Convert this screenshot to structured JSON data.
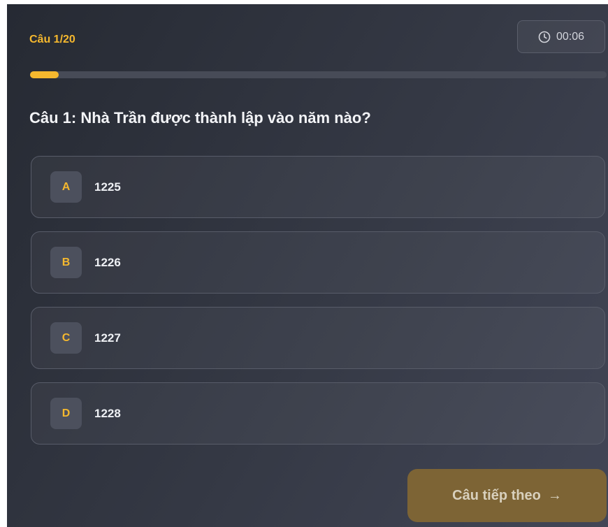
{
  "header": {
    "counter": "Câu 1/20",
    "timer": "00:06",
    "timer_icon": "clock-icon",
    "progress": 0.05
  },
  "question": "Câu 1: Nhà Trần được thành lập vào năm nào?",
  "options": [
    {
      "letter": "A",
      "text": "1225"
    },
    {
      "letter": "B",
      "text": "1226"
    },
    {
      "letter": "C",
      "text": "1227"
    },
    {
      "letter": "D",
      "text": "1228"
    }
  ],
  "next_button": {
    "label": "Câu tiếp theo",
    "arrow": "→"
  },
  "colors": {
    "accent": "#f5b82e",
    "background": "#2f333d"
  }
}
